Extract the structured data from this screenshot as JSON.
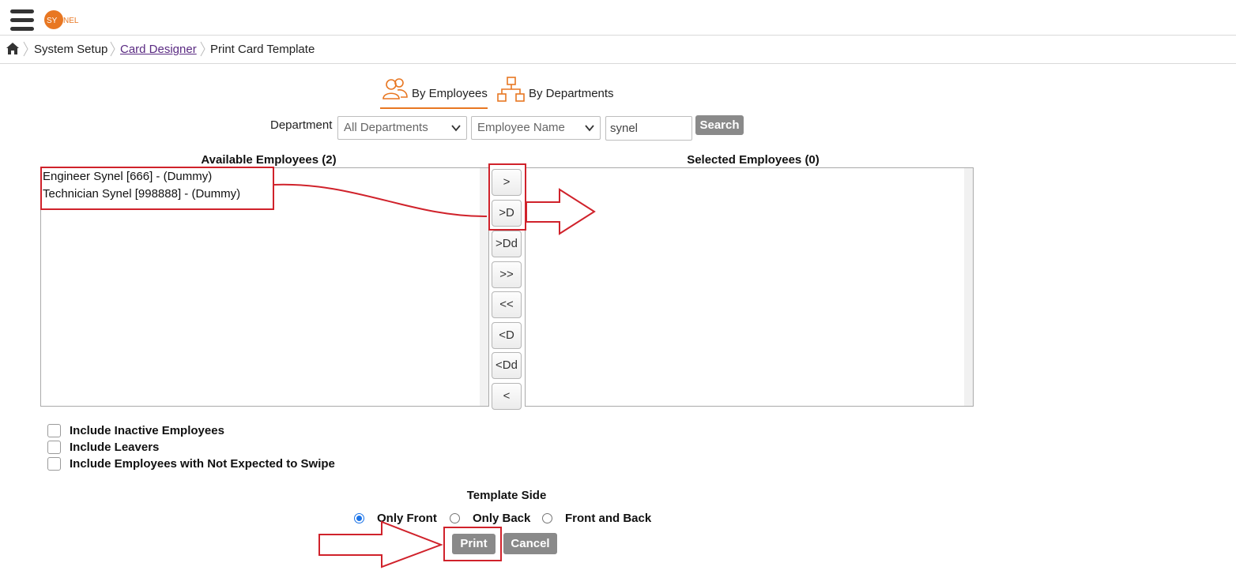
{
  "logo": {
    "text_left": "SY",
    "text_right": "NEL",
    "color": "#e87722"
  },
  "breadcrumb": {
    "items": [
      "System Setup",
      "Card Designer",
      "Print Card Template"
    ]
  },
  "tabs": [
    {
      "label": "By Employees",
      "icon": "users-icon",
      "active": true
    },
    {
      "label": "By Departments",
      "icon": "org-chart-icon",
      "active": false
    }
  ],
  "filters": {
    "department_label": "Department",
    "department_select": "All Departments",
    "field_select": "Employee Name",
    "search_value": "synel",
    "search_button": "Search"
  },
  "available": {
    "heading": "Available Employees (2)",
    "items": [
      "Engineer Synel [666] - (Dummy)",
      "Technician Synel [998888] - (Dummy)"
    ]
  },
  "selected": {
    "heading": "Selected Employees (0)",
    "items": []
  },
  "transfer_buttons": [
    ">",
    ">D",
    ">Dd",
    ">>",
    "<<",
    "<D",
    "<Dd",
    "<"
  ],
  "options": [
    {
      "label": "Include Inactive Employees",
      "checked": false
    },
    {
      "label": "Include Leavers",
      "checked": false
    },
    {
      "label": "Include Employees with Not Expected to Swipe",
      "checked": false
    }
  ],
  "template_side": {
    "heading": "Template Side",
    "options": [
      {
        "label": "Only Front",
        "checked": true
      },
      {
        "label": "Only Back",
        "checked": false
      },
      {
        "label": "Front and Back",
        "checked": false
      }
    ]
  },
  "actions": {
    "print": "Print",
    "cancel": "Cancel"
  },
  "colors": {
    "accent": "#e87722",
    "annotation": "#d0222b",
    "link": "#5a2a82",
    "button": "#8a8a8a"
  }
}
